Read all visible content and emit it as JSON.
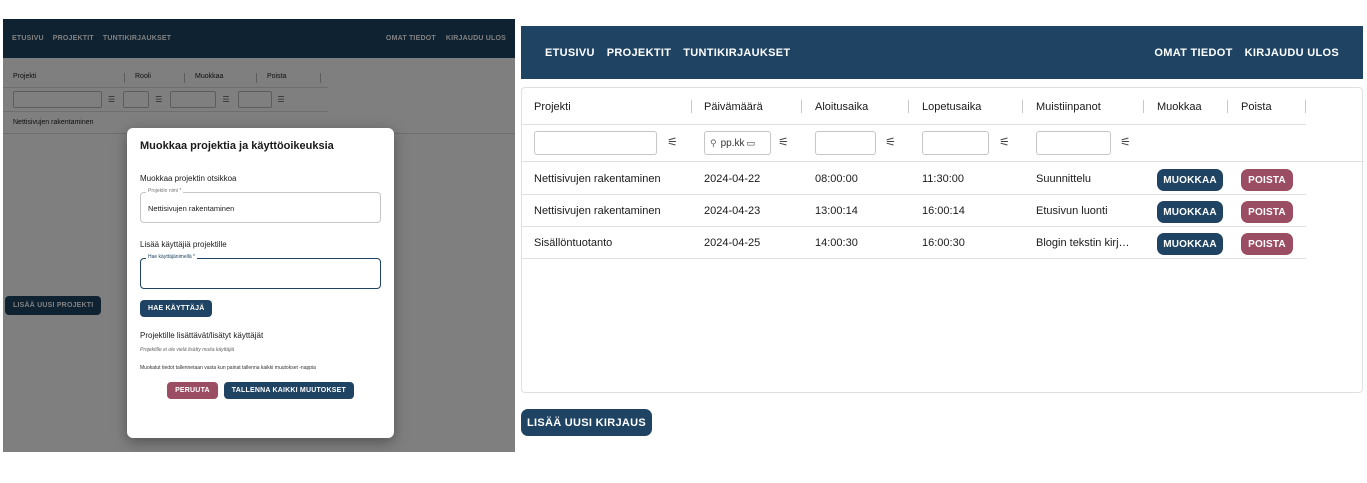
{
  "left": {
    "nav": {
      "home": "ETUSIVU",
      "projects": "PROJEKTIT",
      "hours": "TUNTIKIRJAUKSET",
      "profile": "OMAT TIEDOT",
      "logout": "KIRJAUDU ULOS"
    },
    "table": {
      "headers": [
        "Projekti",
        "Rooli",
        "Muokkaa",
        "Poista"
      ],
      "rows": [
        {
          "project": "Nettisivujen rakentaminen"
        }
      ]
    },
    "add_project_button": "LISÄÄ UUSI PROJEKTI",
    "modal": {
      "title": "Muokkaa projektia ja käyttöoikeuksia",
      "edit_title_label": "Muokkaa projektin otsikkoa",
      "project_name_label": "Projektin nimi *",
      "project_name_value": "Nettisivujen rakentaminen",
      "add_users_label": "Lisää käyttäjiä projektille",
      "username_label": "Hae käyttäjänimellä *",
      "username_value": "",
      "search_button": "HAE KÄYTTÄJÄ",
      "added_users_label": "Projektille lisättävät/lisätyt käyttäjät",
      "no_users_text": "Projektille ei ole vielä lisätty muita käyttäjiä",
      "save_note": "Muokatut tiedot tallennetaan vasta kun painat tallenna kaikki muutokset -nappia",
      "cancel_button": "PERUUTA",
      "save_button": "TALLENNA KAIKKI MUUTOKSET"
    }
  },
  "right": {
    "nav": {
      "home": "ETUSIVU",
      "projects": "PROJEKTIT",
      "hours": "TUNTIKIRJAUKSET",
      "profile": "OMAT TIEDOT",
      "logout": "KIRJAUDU ULOS"
    },
    "grid": {
      "headers": [
        "Projekti",
        "Päivämäärä",
        "Aloitusaika",
        "Lopetusaika",
        "Muistiinpanot",
        "Muokkaa",
        "Poista"
      ],
      "date_filter_placeholder": "pp.kk",
      "rows": [
        {
          "project": "Nettisivujen rakentaminen",
          "date": "2024-04-22",
          "start": "08:00:00",
          "end": "11:30:00",
          "notes": "Suunnittelu"
        },
        {
          "project": "Nettisivujen rakentaminen",
          "date": "2024-04-23",
          "start": "13:00:14",
          "end": "16:00:14",
          "notes": "Etusivun luonti"
        },
        {
          "project": "Sisällöntuotanto",
          "date": "2024-04-25",
          "start": "14:00:30",
          "end": "16:00:30",
          "notes": "Blogin tekstin kirj…"
        }
      ],
      "edit_label": "MUOKKAA",
      "delete_label": "POISTA"
    },
    "add_entry_button": "LISÄÄ UUSI KIRJAUS"
  },
  "colors": {
    "primary": "#1f4463",
    "danger": "#9b4d63",
    "overlay": "rgba(0,0,0,0.5)"
  },
  "icons": {
    "filter": "filter-icon",
    "search": "search-icon",
    "calendar": "calendar-icon"
  }
}
